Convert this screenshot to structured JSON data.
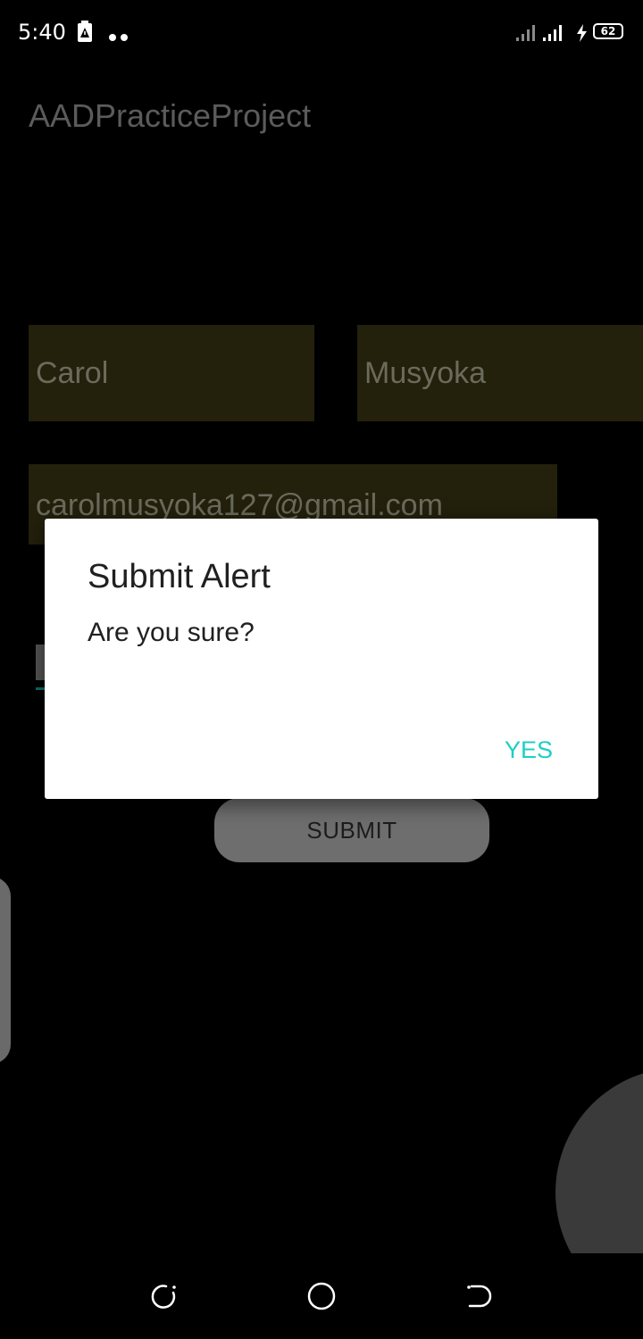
{
  "status_bar": {
    "time": "5:40",
    "battery_level": "62",
    "icons": [
      "notification-icon",
      "more-dots-icon",
      "signal-icon",
      "signal-icon",
      "charging-icon",
      "battery-icon"
    ]
  },
  "app": {
    "title": "AADPracticeProject"
  },
  "form": {
    "first_name": "Carol",
    "last_name": "Musyoka",
    "email": "carolmusyoka127@gmail.com",
    "submit_label": "SUBMIT"
  },
  "dialog": {
    "title": "Submit Alert",
    "message": "Are you sure?",
    "positive_label": "YES",
    "accent_color": "#1ccfc4"
  },
  "nav_bar": {
    "icons": [
      "recent-apps-icon",
      "home-icon",
      "back-icon"
    ]
  },
  "colors": {
    "background": "#000000",
    "field_background": "#23200c",
    "dialog_background": "#ffffff"
  }
}
